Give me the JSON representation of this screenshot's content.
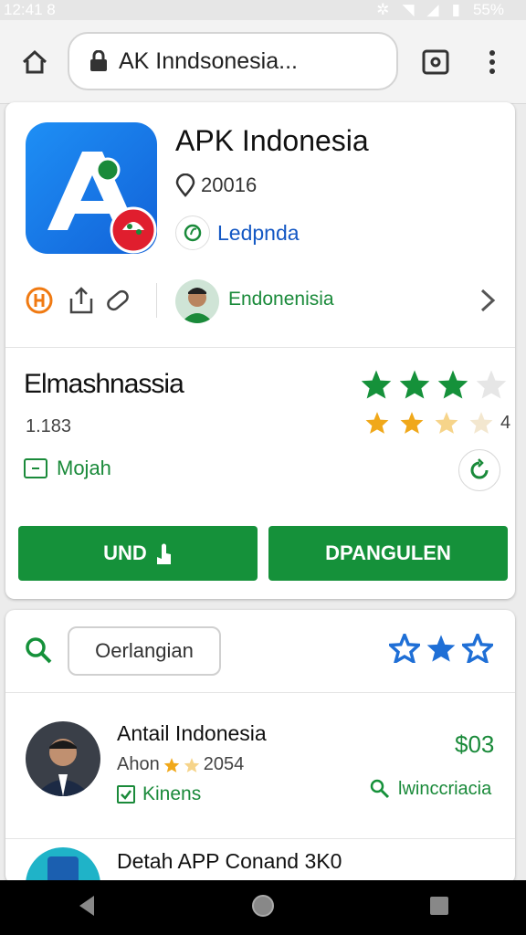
{
  "status_bar": {
    "time": "12:41 8",
    "battery": "55%"
  },
  "browser": {
    "url_text": "AK Inndsonesia..."
  },
  "app": {
    "title": "APK Indonesia",
    "meta": "20016",
    "developer": "Ledpnda",
    "publisher": "Endonenisia"
  },
  "rating": {
    "title": "Elmashnassia",
    "count": "1.183",
    "tag": "Mojah",
    "sub_score": "4"
  },
  "buttons": {
    "install": "UND",
    "open": "DPANGULEN"
  },
  "search": {
    "chip": "Oerlangian"
  },
  "list": [
    {
      "title": "Antail Indonesia",
      "sub": "Ahon",
      "sub_num": "2054",
      "badge": "Kinens",
      "price": "$03",
      "link": "lwinccriacia"
    },
    {
      "title": "Detah APP Conand 3K0"
    }
  ],
  "colors": {
    "green": "#15913a",
    "blue": "#1458c4",
    "star_gold": "#f0a81a"
  }
}
